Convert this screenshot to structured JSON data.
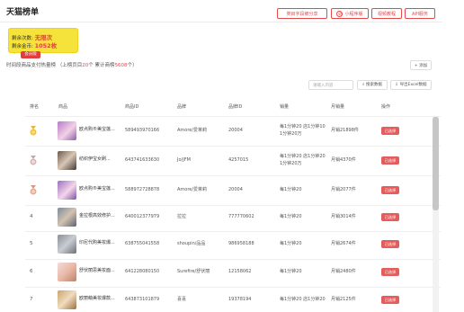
{
  "page": {
    "title": "天猫榜单"
  },
  "top_buttons": [
    {
      "label": "类目字段被分享"
    },
    {
      "label": "小程序版"
    },
    {
      "label": "视频教程"
    },
    {
      "label": "API服务"
    }
  ],
  "promo": {
    "line1_label": "剩余次数:",
    "line1_value": "无限次",
    "line2_label": "剩余金币:",
    "line2_value": "1052枚",
    "badge": "会员版"
  },
  "summary": {
    "prefix": "时间段商品支付热量榜",
    "update_prefix": "（上榜页目",
    "update_count": "20",
    "update_suffix": "个",
    "total_prefix": "累计商榜",
    "total_count": "5608",
    "total_suffix": "个）"
  },
  "add_button": "+ 添加",
  "search": {
    "placeholder": "请输入内容",
    "button1": "搜索数据",
    "button2": "导出Excel数据"
  },
  "table": {
    "headers": [
      "排名",
      "商品",
      "商品ID",
      "品牌",
      "品牌ID",
      "销量",
      "月销量",
      "操作"
    ],
    "rows": [
      {
        "rank": "1",
        "name": "欧点购®美宝莲...",
        "id": "589493970166",
        "brand": "Amore/爱茉莉",
        "brand_id": "20004",
        "sales1": "每1分钟20 店1分钟10",
        "sales2": "1分钟20万",
        "monthly": "月销21898件",
        "action": "已选择"
      },
      {
        "rank": "2",
        "name": "纺织伊宝女刷...",
        "id": "643741633630",
        "brand": "Jo/JFM",
        "brand_id": "4257015",
        "sales1": "每1分钟20 店1分钟20",
        "sales2": "1分钟20万",
        "monthly": "月销4370件",
        "action": "已选择"
      },
      {
        "rank": "3",
        "name": "欧点购®美宝莲...",
        "id": "588972728878",
        "brand": "Amore/爱茉莉",
        "brand_id": "20004",
        "sales1": "每1分钟20",
        "sales2": "",
        "monthly": "月销2077件",
        "action": "已选择"
      },
      {
        "rank": "4",
        "name": "金拉根高效修护...",
        "id": "640012377979",
        "brand": "拉拉",
        "brand_id": "777770602",
        "sales1": "每1分钟20",
        "sales2": "",
        "monthly": "月销3014件",
        "action": "已选择"
      },
      {
        "rank": "5",
        "name": "印尼代购美妆爆...",
        "id": "638755041558",
        "brand": "shoupin/品品",
        "brand_id": "986958188",
        "sales1": "每1分钟20",
        "sales2": "",
        "monthly": "月销2674件",
        "action": "已选择"
      },
      {
        "rank": "6",
        "name": "舒伏丽思美妆面...",
        "id": "641228080150",
        "brand": "Surefire/舒伏丽",
        "brand_id": "12158062",
        "sales1": "每1分钟20",
        "sales2": "",
        "monthly": "月销2480件",
        "action": "已选择"
      },
      {
        "rank": "7",
        "name": "欧丽萌美妆爆款...",
        "id": "643873101879",
        "brand": "喜喜",
        "brand_id": "19378194",
        "sales1": "每1分钟20 店1分钟20",
        "sales2": "",
        "monthly": "月销2125件",
        "action": "已选择"
      }
    ]
  },
  "colors": {
    "accent": "#e34a4a",
    "promo_yellow": "#f5e23a"
  }
}
